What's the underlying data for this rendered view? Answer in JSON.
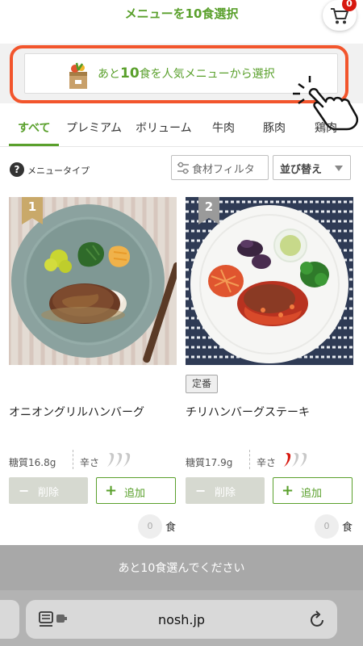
{
  "header": {
    "title": "メニューを10食選択",
    "cart_count": "0"
  },
  "banner": {
    "prefix": "あと",
    "count": "10",
    "suffix": "食を人気メニューから選択"
  },
  "tabs": [
    {
      "label": "すべて",
      "active": true
    },
    {
      "label": "プレミアム"
    },
    {
      "label": "ボリューム"
    },
    {
      "label": "牛肉"
    },
    {
      "label": "豚肉"
    },
    {
      "label": "鶏肉"
    }
  ],
  "controls": {
    "menu_type_label": "メニュータイプ",
    "filter_label": "食材フィルタ",
    "sort_label": "並び替え"
  },
  "products": [
    {
      "rank": "1",
      "name": "オニオングリルハンバーグ",
      "carb": "糖質16.8g",
      "spice_label": "辛さ",
      "spice_level": 0,
      "remove_label": "削除",
      "add_label": "追加",
      "quantity": "0",
      "unit": "食"
    },
    {
      "rank": "2",
      "tag": "定番",
      "name": "チリハンバーグステーキ",
      "carb": "糖質17.9g",
      "spice_label": "辛さ",
      "spice_level": 1,
      "remove_label": "削除",
      "add_label": "追加",
      "quantity": "0",
      "unit": "食"
    }
  ],
  "status_bar": {
    "message": "あと10食選んでください"
  },
  "browser": {
    "url": "nosh.jp"
  },
  "colors": {
    "brand_green": "#5aa02c",
    "highlight_orange": "#f2552c",
    "badge_red": "#d7180f"
  }
}
